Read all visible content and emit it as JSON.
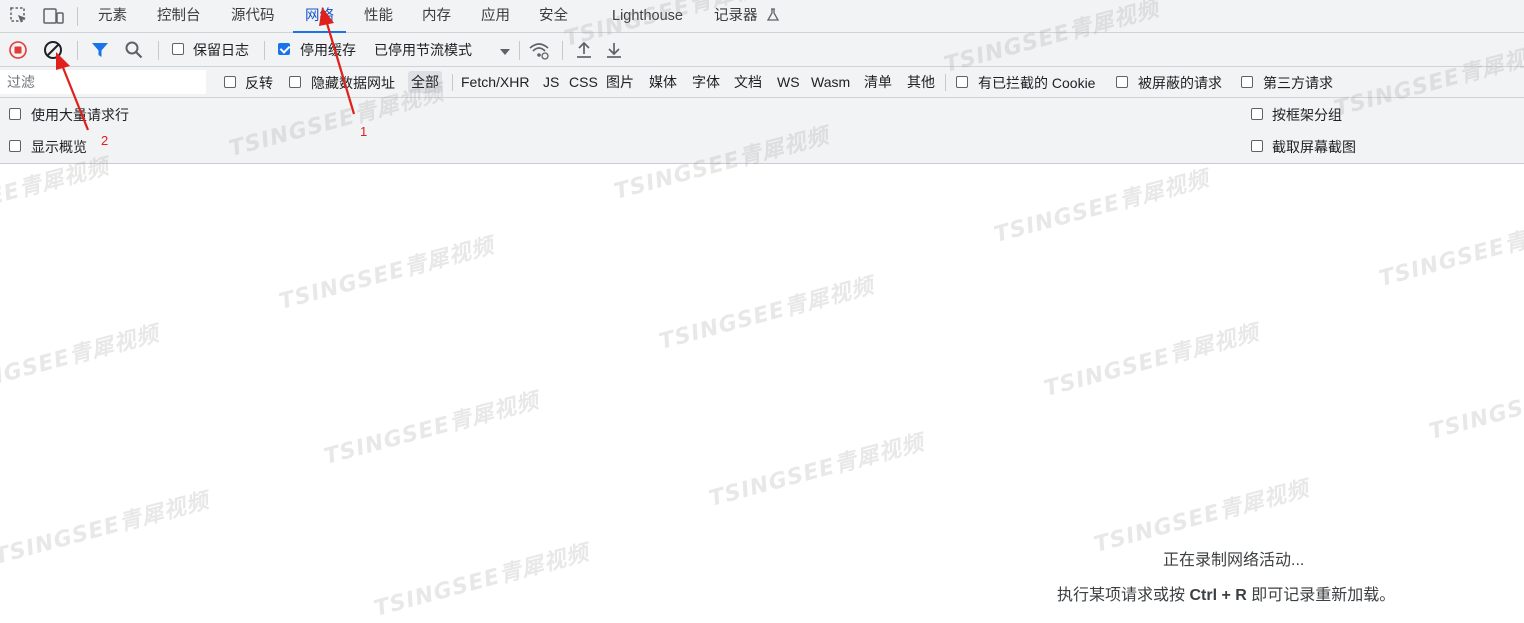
{
  "tabs": {
    "elements": "元素",
    "console": "控制台",
    "sources": "源代码",
    "network": "网络",
    "performance": "性能",
    "memory": "内存",
    "application": "应用",
    "security": "安全",
    "lighthouse": "Lighthouse",
    "recorder": "记录器"
  },
  "toolbar": {
    "preserve_log": "保留日志",
    "disable_cache": "停用缓存",
    "throttling": "已停用节流模式"
  },
  "filter": {
    "placeholder": "过滤",
    "invert": "反转",
    "hide_data_urls": "隐藏数据网址",
    "types": {
      "all": "全部",
      "fetch_xhr": "Fetch/XHR",
      "js": "JS",
      "css": "CSS",
      "img": "图片",
      "media": "媒体",
      "font": "字体",
      "doc": "文档",
      "ws": "WS",
      "wasm": "Wasm",
      "manifest": "清单",
      "other": "其他"
    },
    "blocked_cookies": "有已拦截的 Cookie",
    "blocked_requests": "被屏蔽的请求",
    "third_party": "第三方请求"
  },
  "options": {
    "big_rows": "使用大量请求行",
    "overview": "显示概览",
    "group_by_frame": "按框架分组",
    "screenshots": "截取屏幕截图"
  },
  "empty_state": {
    "line1": "正在录制网络活动...",
    "line2_prefix": "执行某项请求或按 ",
    "line2_keys": "Ctrl + R",
    "line2_suffix": " 即可记录重新加载。"
  },
  "annotations": {
    "a1": "1",
    "a2": "2"
  },
  "watermark": "TSINGSEE青犀视频",
  "colors": {
    "accent": "#1a73e8",
    "record_red": "#e53935",
    "annotation_red": "#e0201b"
  },
  "state": {
    "preserve_log": false,
    "disable_cache": true,
    "active_tab": "network",
    "selected_type": "all"
  }
}
